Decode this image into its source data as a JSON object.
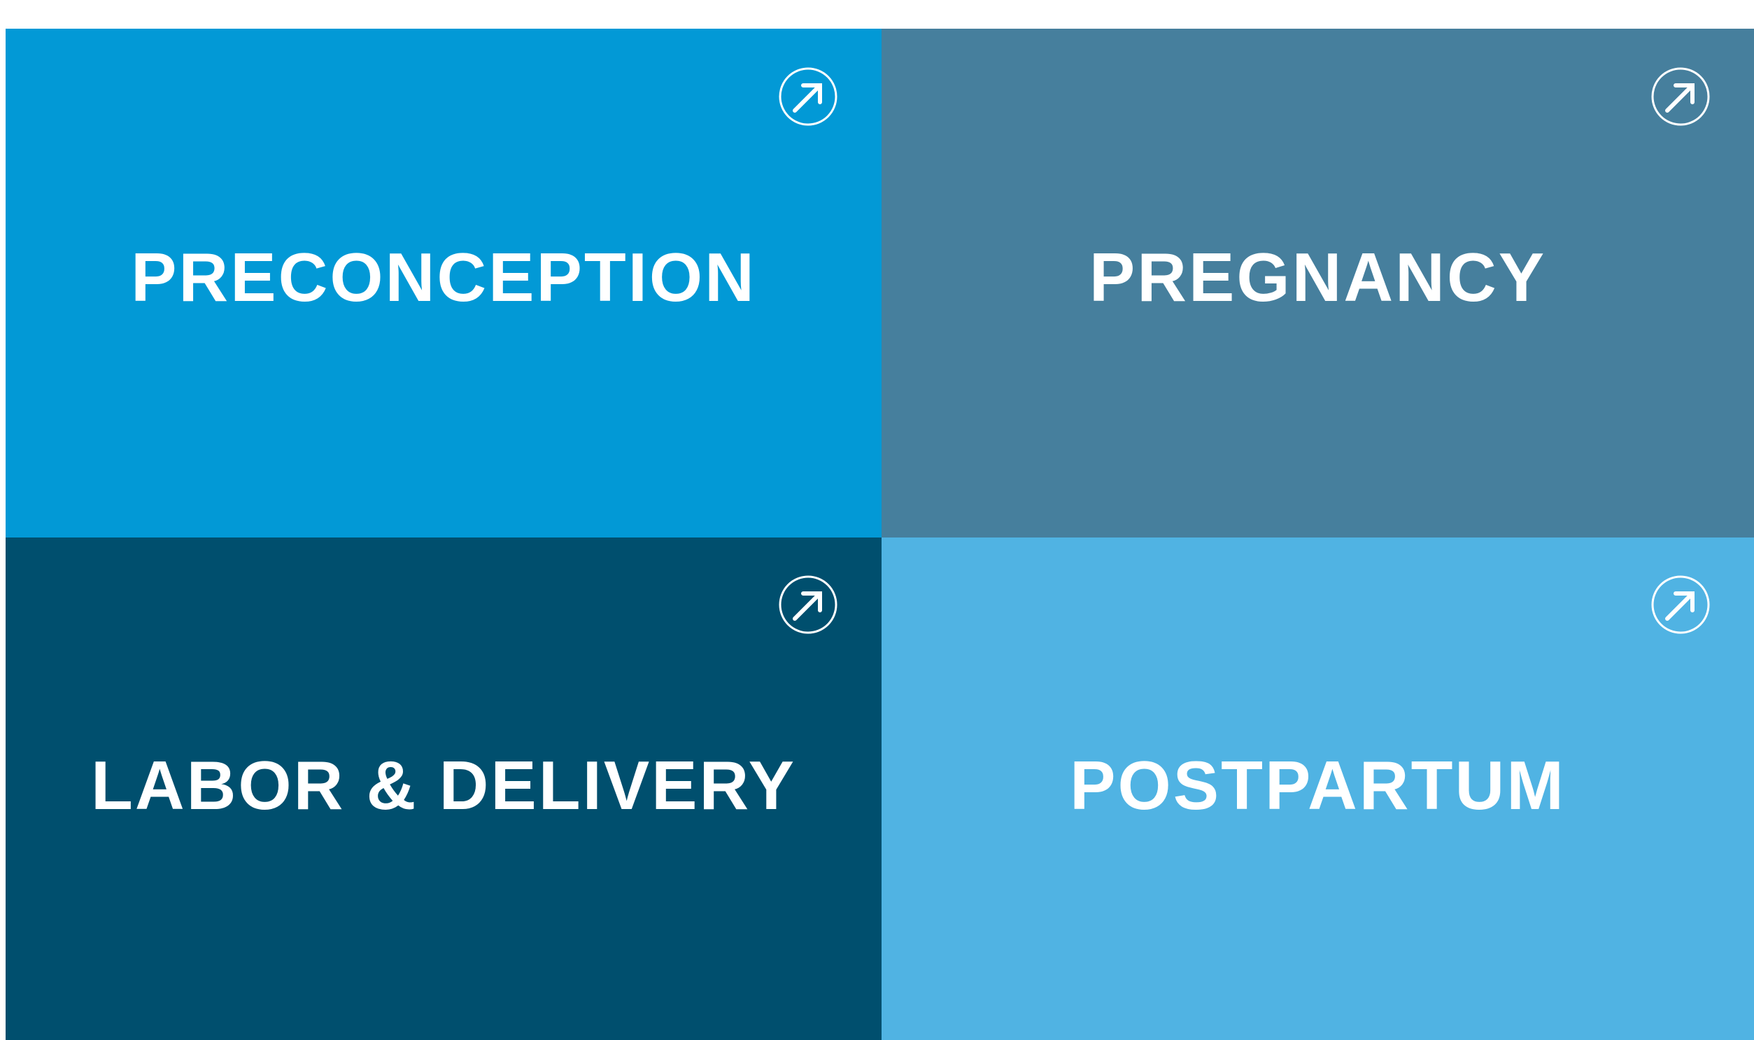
{
  "tiles": [
    {
      "id": "preconception",
      "label": "PRECONCEPTION",
      "background": "#0299d6",
      "icon": "arrow-up-right-circle-icon"
    },
    {
      "id": "pregnancy",
      "label": "PREGNANCY",
      "background": "#467f9d",
      "icon": "arrow-up-right-circle-icon"
    },
    {
      "id": "labor-delivery",
      "label": "LABOR & DELIVERY",
      "background": "#004f6e",
      "icon": "arrow-up-right-circle-icon"
    },
    {
      "id": "postpartum",
      "label": "POSTPARTUM",
      "background": "#50b3e3",
      "icon": "arrow-up-right-circle-icon"
    }
  ]
}
